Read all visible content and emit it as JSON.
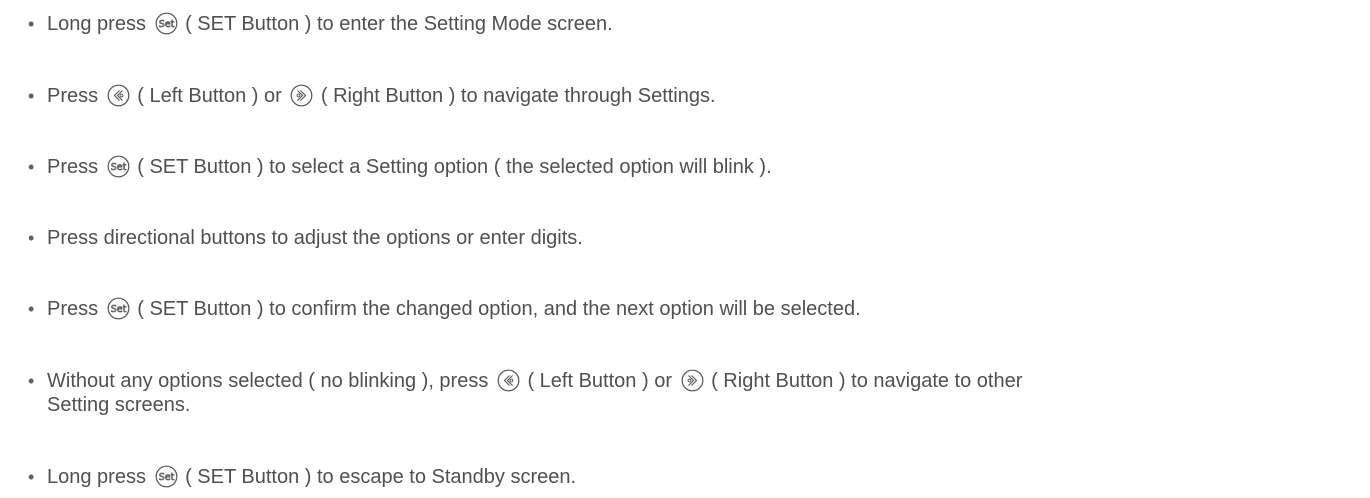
{
  "instructions": [
    {
      "before": "Long press ",
      "icon": "set-button-icon",
      "after": " ( SET Button ) to enter the Setting Mode screen."
    },
    {
      "before": "Press ",
      "icon": "left-button-icon",
      "middle": " ( Left Button ) or ",
      "icon2": "right-button-icon",
      "after": " ( Right Button ) to navigate through Settings."
    },
    {
      "before": "Press ",
      "icon": "set-button-icon",
      "after": " ( SET Button ) to select a Setting option ( the selected option will blink )."
    },
    {
      "text": "Press directional buttons to adjust the options or enter digits."
    },
    {
      "before": "Press ",
      "icon": "set-button-icon",
      "after": " ( SET Button ) to confirm the changed option, and the next option will be selected."
    },
    {
      "before": "Without any options selected ( no blinking ), press ",
      "icon": "left-button-icon",
      "middle": " ( Left Button ) or ",
      "icon2": "right-button-icon",
      "after": " ( Right Button ) to navigate to other",
      "continuation": "Setting screens."
    },
    {
      "before": "Long press ",
      "icon": "set-button-icon",
      "after": " ( SET Button ) to escape to Standby screen."
    }
  ],
  "bullet_char": "•",
  "colors": {
    "text": "#505050",
    "icon_stroke": "#555555"
  },
  "icon_glyph_set": "Set"
}
